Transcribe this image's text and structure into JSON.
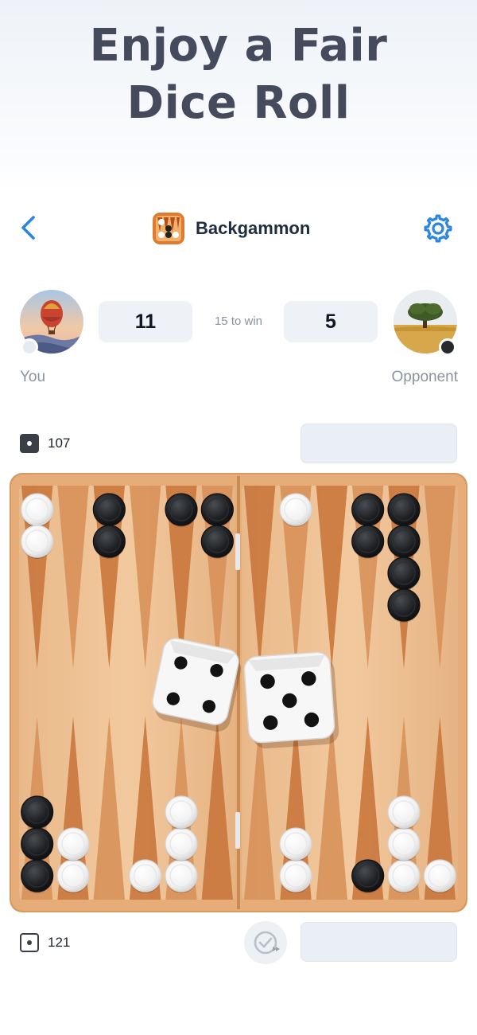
{
  "promo": {
    "line1": "Enjoy a Fair",
    "line2": "Dice Roll"
  },
  "header": {
    "back_icon": "chevron-left-icon",
    "title": "Backgammon",
    "app_icon": "backgammon-app-icon",
    "settings_icon": "gear-icon"
  },
  "players": {
    "you": {
      "name": "You",
      "score": "11",
      "avatar": "hot-air-balloon-avatar",
      "chip_color": "white"
    },
    "opponent": {
      "name": "Opponent",
      "score": "5",
      "avatar": "tree-field-avatar",
      "chip_color": "black"
    }
  },
  "match": {
    "target_label": "15 to win"
  },
  "pip_counts": {
    "opponent": {
      "value": "107",
      "icon": "dark-die-icon"
    },
    "you": {
      "value": "121",
      "icon": "light-die-icon"
    }
  },
  "controls": {
    "undo_icon": "undo-check-icon"
  },
  "board": {
    "dice": [
      4,
      5
    ],
    "checkers": [
      {
        "point": 13,
        "color": "white",
        "count": 2
      },
      {
        "point": 15,
        "color": "black",
        "count": 2
      },
      {
        "point": 17,
        "color": "black",
        "count": 1
      },
      {
        "point": 18,
        "color": "black",
        "count": 2
      },
      {
        "point": 20,
        "color": "white",
        "count": 1
      },
      {
        "point": 22,
        "color": "black",
        "count": 2
      },
      {
        "point": 23,
        "color": "black",
        "count": 4
      },
      {
        "point": 1,
        "color": "white",
        "count": 1
      },
      {
        "point": 2,
        "color": "white",
        "count": 3
      },
      {
        "point": 3,
        "color": "black",
        "count": 1
      },
      {
        "point": 5,
        "color": "white",
        "count": 2
      },
      {
        "point": 8,
        "color": "white",
        "count": 3
      },
      {
        "point": 9,
        "color": "white",
        "count": 1
      },
      {
        "point": 11,
        "color": "white",
        "count": 2
      },
      {
        "point": 12,
        "color": "black",
        "count": 3
      }
    ]
  }
}
